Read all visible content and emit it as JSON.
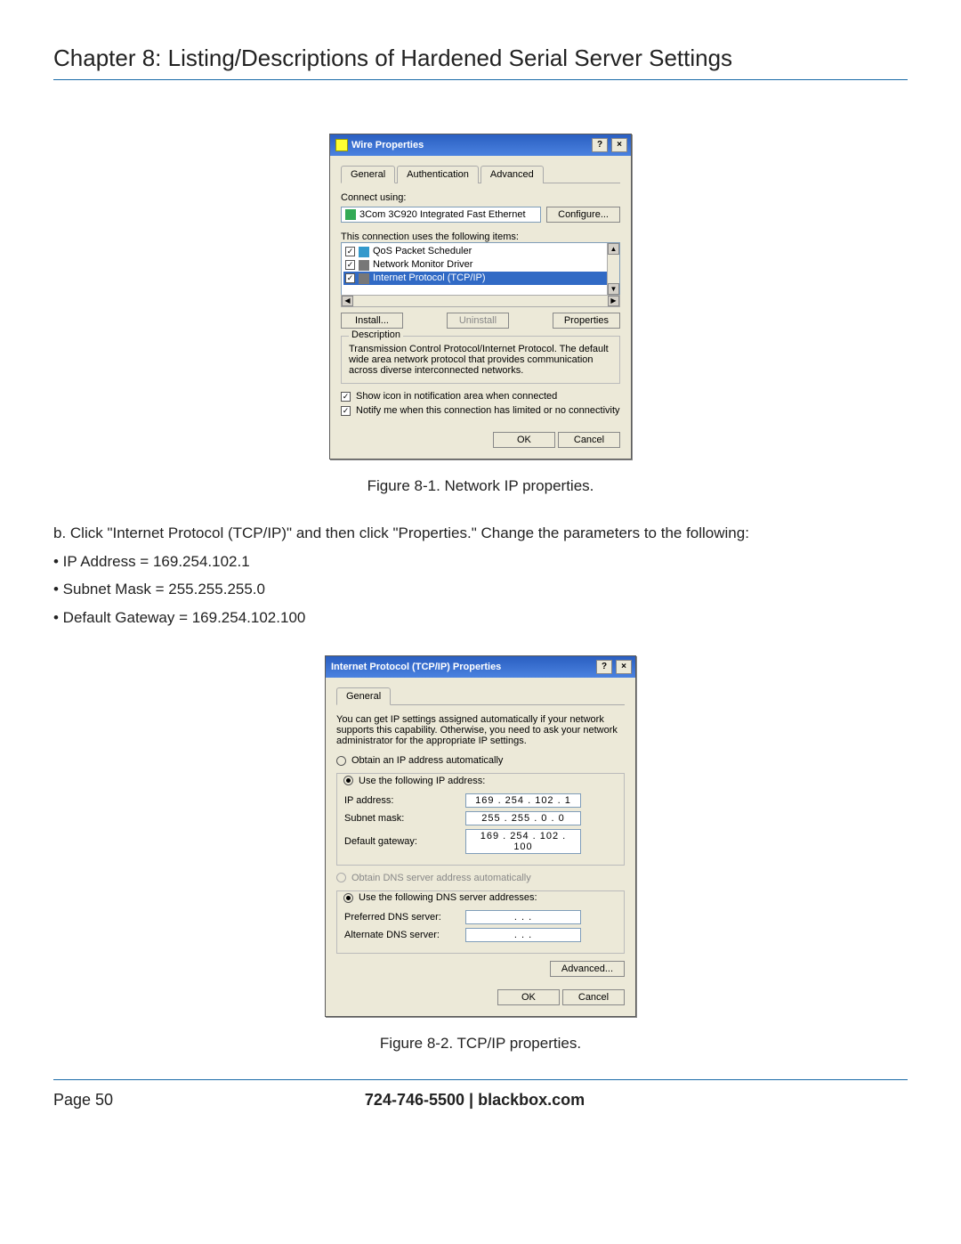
{
  "chapter_title": "Chapter 8: Listing/Descriptions of Hardened Serial Server Settings",
  "fig1": {
    "caption": "Figure 8-1. Network IP properties.",
    "title": "Wire Properties",
    "tabs": [
      "General",
      "Authentication",
      "Advanced"
    ],
    "connect_using_label": "Connect using:",
    "adapter": "3Com 3C920 Integrated Fast Ethernet",
    "configure_btn": "Configure...",
    "items_label": "This connection uses the following items:",
    "items": [
      "QoS Packet Scheduler",
      "Network Monitor Driver",
      "Internet Protocol (TCP/IP)"
    ],
    "install_btn": "Install...",
    "uninstall_btn": "Uninstall",
    "properties_btn": "Properties",
    "desc_title": "Description",
    "desc": "Transmission Control Protocol/Internet Protocol. The default wide area network protocol that provides communication across diverse interconnected networks.",
    "show_icon": "Show icon in notification area when connected",
    "notify": "Notify me when this connection has limited or no connectivity",
    "ok": "OK",
    "cancel": "Cancel"
  },
  "instruction_b": "b. Click \"Internet Protocol (TCP/IP)\" and then click \"Properties.\" Change the parameters to the following:",
  "bullets": [
    "• IP Address = 169.254.102.1",
    "• Subnet Mask = 255.255.255.0",
    "• Default Gateway = 169.254.102.100"
  ],
  "fig2": {
    "caption": "Figure 8-2. TCP/IP properties.",
    "title": "Internet Protocol (TCP/IP) Properties",
    "tab": "General",
    "intro": "You can get IP settings assigned automatically if your network supports this capability. Otherwise, you need to ask your network administrator for the appropriate IP settings.",
    "obtain_ip": "Obtain an IP address automatically",
    "use_ip": "Use the following IP address:",
    "ip_label": "IP address:",
    "ip_val": "169 . 254 . 102 .   1",
    "subnet_label": "Subnet mask:",
    "subnet_val": "255 . 255 .   0  .   0",
    "gw_label": "Default gateway:",
    "gw_val": "169 . 254 . 102 . 100",
    "obtain_dns": "Obtain DNS server address automatically",
    "use_dns": "Use the following DNS server addresses:",
    "pref_dns": "Preferred DNS server:",
    "alt_dns": "Alternate DNS server:",
    "advanced": "Advanced...",
    "ok": "OK",
    "cancel": "Cancel"
  },
  "footer": {
    "page": "Page 50",
    "phone": "724-746-5500",
    "sep": "   |   ",
    "site": "blackbox.com"
  }
}
